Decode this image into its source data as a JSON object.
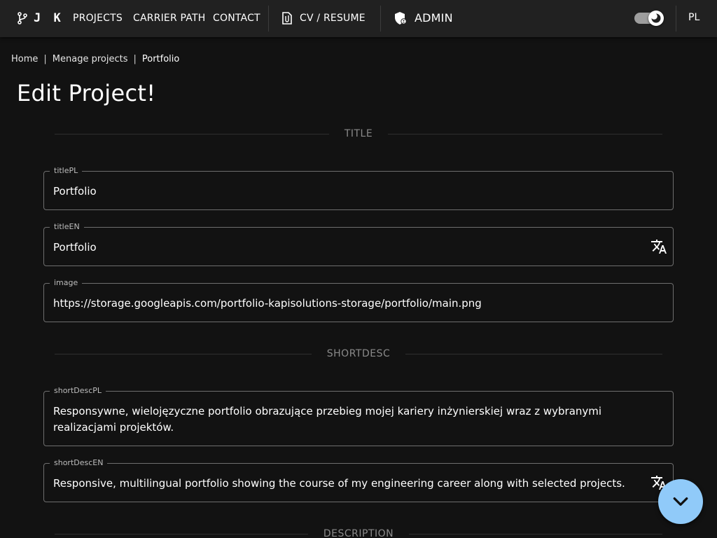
{
  "header": {
    "logo_text": "J K",
    "nav": {
      "projects": "PROJECTS",
      "carrier_path": "CARRIER PATH",
      "contact": "CONTACT",
      "cv_resume": "CV / RESUME",
      "admin": "ADMIN"
    },
    "theme_toggle_on": true,
    "language": "PL"
  },
  "breadcrumb": {
    "items": [
      "Home",
      "Menage projects",
      "Portfolio"
    ],
    "separator": "|"
  },
  "page_title": "Edit Project!",
  "sections": {
    "title": "TITLE",
    "shortdesc": "SHORTDESC",
    "description": "DESCRIPTION"
  },
  "fields": {
    "title_pl": {
      "label": "titlePL",
      "value": "Portfolio"
    },
    "title_en": {
      "label": "titleEN",
      "value": "Portfolio"
    },
    "image": {
      "label": "image",
      "value": "https://storage.googleapis.com/portfolio-kapisolutions-storage/portfolio/main.png"
    },
    "short_desc_pl": {
      "label": "shortDescPL",
      "value": "Responsywne, wielojęzyczne portfolio obrazujące przebieg mojej kariery inżynierskiej wraz z wybranymi realizacjami projektów."
    },
    "short_desc_en": {
      "label": "shortDescEN",
      "value": "Responsive, multilingual portfolio showing the course of my engineering career along with selected projects."
    }
  },
  "colors": {
    "background": "#121212",
    "header": "#212121",
    "field_border": "#6e6e6e",
    "fab": "#90caf9"
  },
  "icons": {
    "logo": "git-branch-icon",
    "cv": "attachment-file-icon",
    "admin": "admin-shield-icon",
    "theme": "dark-mode-icon",
    "translate": "translate-icon",
    "fab": "chevron-down-icon"
  }
}
